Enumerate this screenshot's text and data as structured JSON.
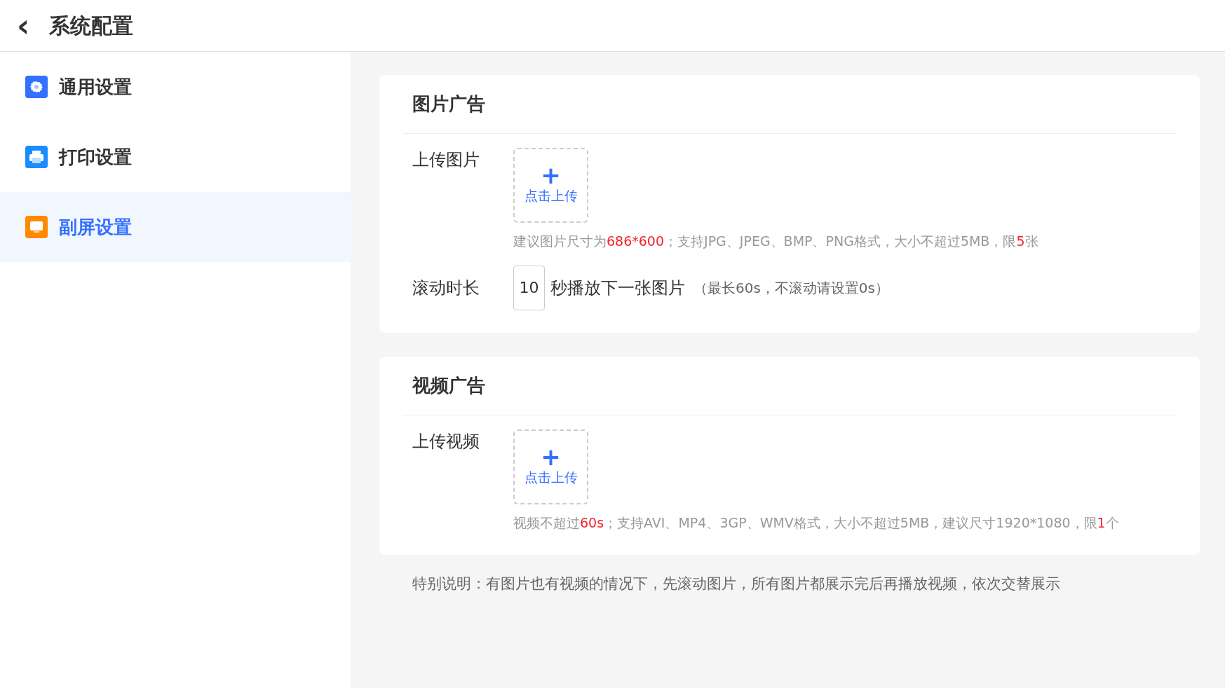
{
  "header": {
    "back_icon": "‹",
    "title": "系统配置"
  },
  "sidebar": {
    "items": [
      {
        "label": "通用设置",
        "kind": "gear",
        "selected": false
      },
      {
        "label": "打印设置",
        "kind": "printer",
        "selected": false
      },
      {
        "label": "副屏设置",
        "kind": "monitor",
        "selected": true
      }
    ]
  },
  "cards": [
    {
      "title": "图片广告",
      "upload": {
        "label": "上传图片",
        "plus": "+",
        "button": "点击上传",
        "hint": [
          {
            "text": "建议图片尺寸为",
            "highlight": false
          },
          {
            "text": "686*600",
            "highlight": true
          },
          {
            "text": "；支持JPG、JPEG、BMP、PNG格式，大小不超过5MB，限",
            "highlight": false
          },
          {
            "text": "5",
            "highlight": true
          },
          {
            "text": "张",
            "highlight": false
          }
        ]
      },
      "duration": {
        "label": "滚动时长",
        "value": "10",
        "suffix": "秒播放下一张图片",
        "note": "（最长60s，不滚动请设置0s）"
      }
    },
    {
      "title": "视频广告",
      "upload": {
        "label": "上传视频",
        "plus": "+",
        "button": "点击上传",
        "hint": [
          {
            "text": "视频不超过",
            "highlight": false
          },
          {
            "text": "60s",
            "highlight": true
          },
          {
            "text": "；支持AVI、MP4、3GP、WMV格式，大小不超过5MB，建议尺寸1920*1080，限",
            "highlight": false
          },
          {
            "text": "1",
            "highlight": true
          },
          {
            "text": "个",
            "highlight": false
          }
        ]
      }
    }
  ],
  "footnote": "特别说明：有图片也有视频的情况下，先滚动图片，所有图片都展示完后再播放视频，依次交替展示"
}
